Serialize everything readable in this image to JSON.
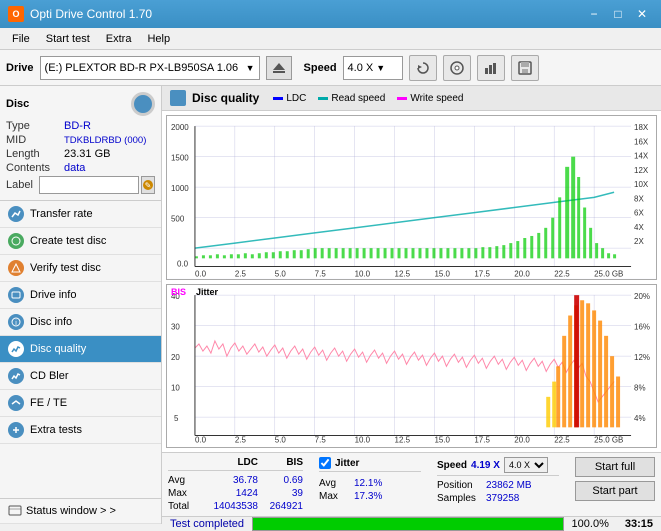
{
  "titlebar": {
    "title": "Opti Drive Control 1.70",
    "icon": "O",
    "controls": [
      "−",
      "□",
      "×"
    ]
  },
  "menubar": {
    "items": [
      "File",
      "Start test",
      "Extra",
      "Help"
    ]
  },
  "toolbar": {
    "drive_label": "Drive",
    "drive_value": "(E:) PLEXTOR BD-R  PX-LB950SA 1.06",
    "speed_label": "Speed",
    "speed_value": "4.0 X"
  },
  "sidebar": {
    "disc_section": {
      "title": "Disc",
      "fields": [
        {
          "key": "Type",
          "value": "BD-R",
          "blue": true
        },
        {
          "key": "MID",
          "value": "TDKBLDRBD (000)",
          "blue": true
        },
        {
          "key": "Length",
          "value": "23.31 GB",
          "blue": false
        },
        {
          "key": "Contents",
          "value": "data",
          "blue": true
        }
      ],
      "label_placeholder": ""
    },
    "nav_items": [
      {
        "id": "transfer-rate",
        "label": "Transfer rate",
        "icon": "blue"
      },
      {
        "id": "create-test-disc",
        "label": "Create test disc",
        "icon": "green"
      },
      {
        "id": "verify-test-disc",
        "label": "Verify test disc",
        "icon": "orange"
      },
      {
        "id": "drive-info",
        "label": "Drive info",
        "icon": "blue"
      },
      {
        "id": "disc-info",
        "label": "Disc info",
        "icon": "blue"
      },
      {
        "id": "disc-quality",
        "label": "Disc quality",
        "icon": "blue",
        "active": true
      },
      {
        "id": "cd-bler",
        "label": "CD Bler",
        "icon": "blue"
      },
      {
        "id": "fe-te",
        "label": "FE / TE",
        "icon": "blue"
      },
      {
        "id": "extra-tests",
        "label": "Extra tests",
        "icon": "blue"
      }
    ],
    "status_window": "Status window > >"
  },
  "content": {
    "title": "Disc quality",
    "legend": [
      {
        "label": "LDC",
        "color": "#0000ff"
      },
      {
        "label": "Read speed",
        "color": "#00aaaa"
      },
      {
        "label": "Write speed",
        "color": "#ff00ff"
      }
    ],
    "legend2": [
      {
        "label": "BIS",
        "color": "#ff00ff"
      },
      {
        "label": "Jitter",
        "color": "#000000"
      }
    ]
  },
  "stats": {
    "headers": [
      "LDC",
      "BIS"
    ],
    "rows": [
      {
        "label": "Avg",
        "ldc": "36.78",
        "bis": "0.69"
      },
      {
        "label": "Max",
        "ldc": "1424",
        "bis": "39"
      },
      {
        "label": "Total",
        "ldc": "14043538",
        "bis": "264921"
      }
    ],
    "jitter": {
      "checked": true,
      "label": "Jitter",
      "rows": [
        {
          "label": "Avg",
          "value": "12.1%"
        },
        {
          "label": "Max",
          "value": "17.3%"
        }
      ]
    },
    "speed": {
      "label": "Speed",
      "value": "4.19 X",
      "speed_select": "4.0 X",
      "position_label": "Position",
      "position_value": "23862 MB",
      "samples_label": "Samples",
      "samples_value": "379258"
    },
    "buttons": {
      "start_full": "Start full",
      "start_part": "Start part"
    }
  },
  "progress": {
    "percent": 100,
    "label": "100.0%",
    "time": "33:15",
    "status_text": "Test completed"
  }
}
